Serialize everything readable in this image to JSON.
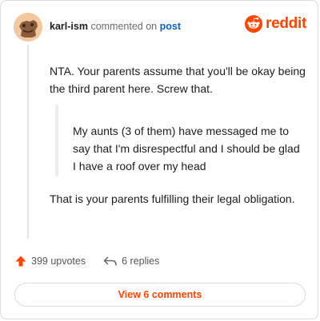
{
  "comment": {
    "username": "karl-ism",
    "action_text": "commented on",
    "target_link": "post",
    "paragraph_1": "NTA. Your parents assume that you'll be okay being the third parent here. Screw that.",
    "quote": "My aunts (3 of them) have messaged me to say that I'm disrespectful and I should be glad I have a roof over my head",
    "paragraph_2": "That is your parents fulfilling their legal obligation."
  },
  "brand": {
    "name": "reddit",
    "color": "#ff4500"
  },
  "actions": {
    "upvotes_label": "399 upvotes",
    "replies_label": "6 replies",
    "upvote_color": "#ff4500"
  },
  "footer": {
    "view_comments_label": "View 6 comments"
  },
  "icons": {
    "avatar": "avatar-icon",
    "brand": "reddit-snoo-icon",
    "upvote": "upvote-arrow-icon",
    "reply": "reply-arrow-icon"
  }
}
